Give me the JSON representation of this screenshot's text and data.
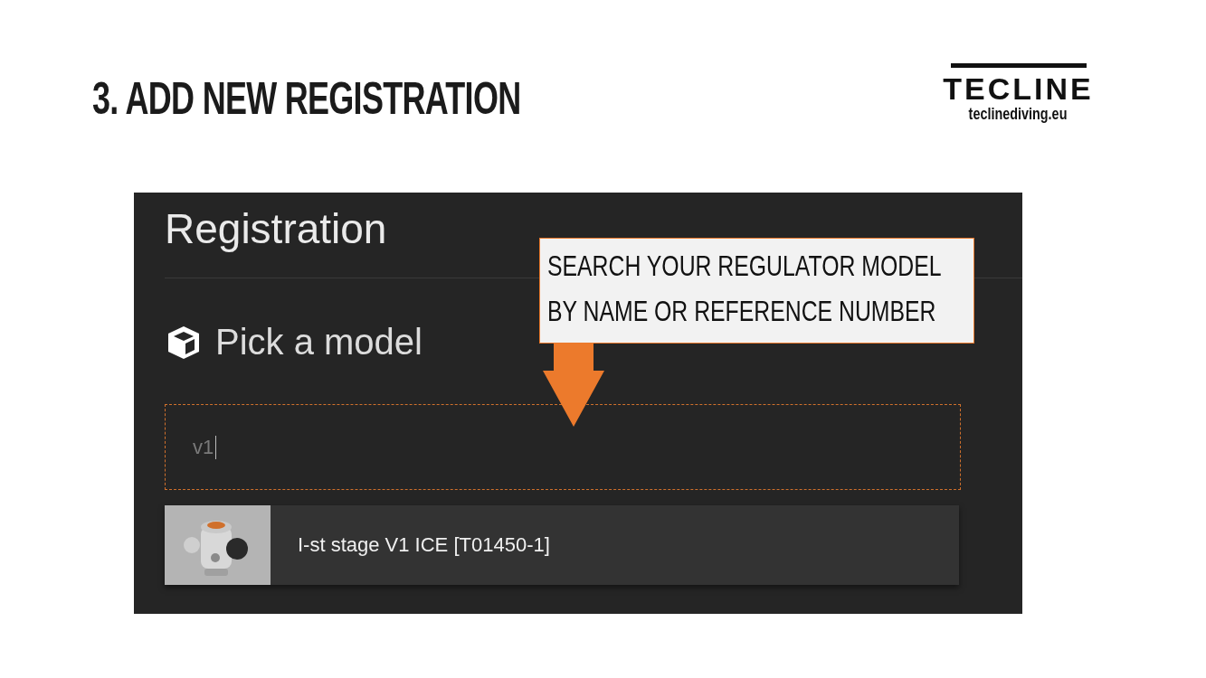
{
  "slide_title": "3. ADD NEW REGISTRATION",
  "logo": {
    "wordmark": "TECLINE",
    "website": "teclinediving.eu"
  },
  "registration": {
    "heading": "Registration",
    "section_title": "Pick a model",
    "search": {
      "value": "v1"
    },
    "results": [
      {
        "kind": "picture",
        "label": "I-st stage V1 ICE [T01450-1]"
      }
    ]
  },
  "callout": {
    "lines": [
      "SEARCH YOUR REGULATOR MODEL",
      "BY NAME OR REFERENCE NUMBER"
    ]
  }
}
